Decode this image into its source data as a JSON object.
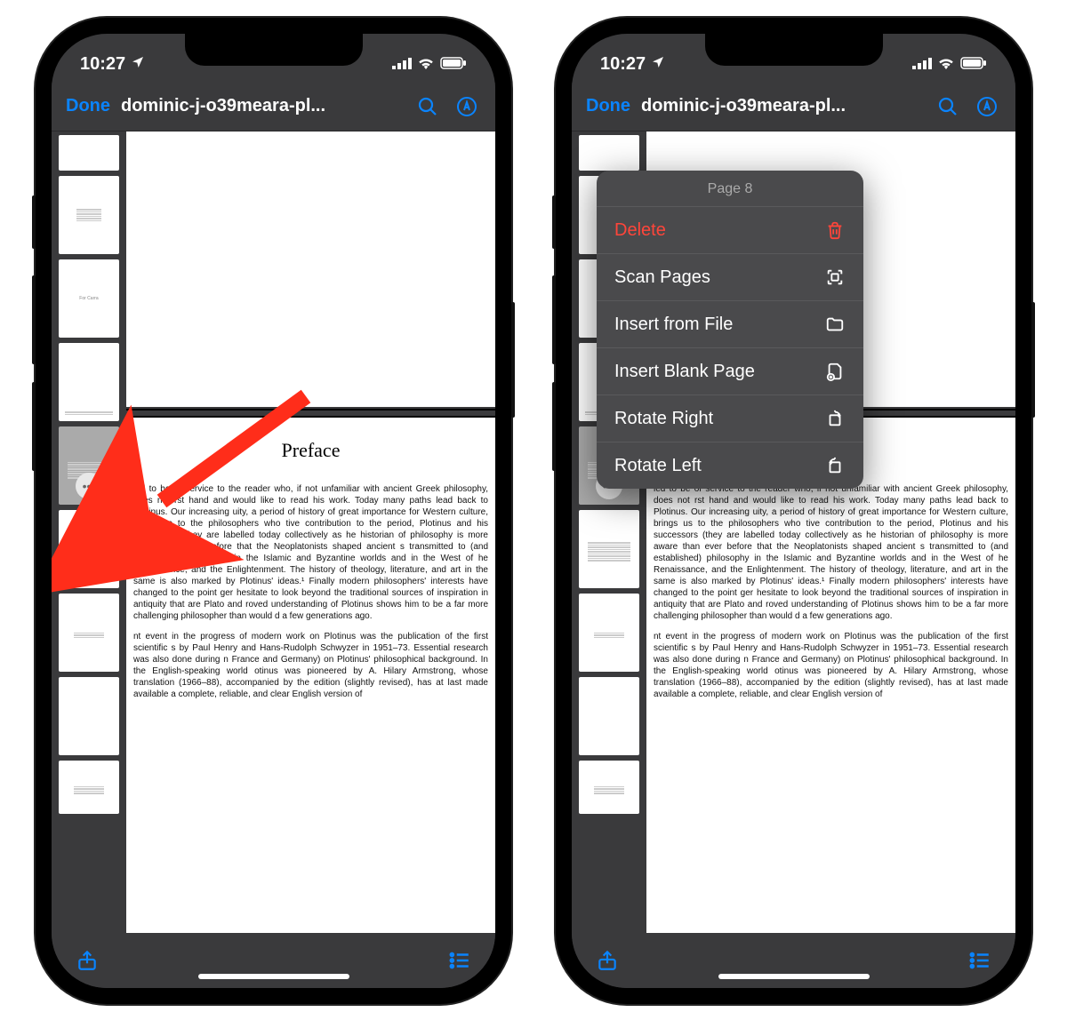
{
  "status": {
    "time": "10:27"
  },
  "nav": {
    "done": "Done",
    "title": "dominic-j-o39meara-pl..."
  },
  "preface": {
    "heading": "Preface",
    "p1": "led to be of service to the reader who, if not unfamiliar with ancient Greek philosophy, does not rst hand and would like to read his work. Today many paths lead back to Plotinus. Our increasing uity, a period of history of great importance for Western culture, brings us to the philosophers who tive contribution to the period, Plotinus and his successors (they are labelled today collectively as he historian of philosophy is more aware than ever before that the Neoplatonists shaped ancient s transmitted to (and established) philosophy in the Islamic and Byzantine worlds and in the West of he Renaissance, and the Enlightenment. The history of theology, literature, and art in the same is also marked by Plotinus' ideas.¹ Finally modern philosophers' interests have changed to the point ger hesitate to look beyond the traditional sources of inspiration in antiquity that are Plato and roved understanding of Plotinus shows him to be a far more challenging philosopher than would d a few generations ago.",
    "p2": "nt event in the progress of modern work on Plotinus was the publication of the first scientific s by Paul Henry and Hans-Rudolph Schwyzer in 1951–73. Essential research was also done during n France and Germany) on Plotinus' philosophical background. In the English-speaking world otinus was pioneered by A. Hilary Armstrong, whose translation (1966–88), accompanied by the edition (slightly revised), has at last made available a complete, reliable, and clear English version of"
  },
  "menu": {
    "title": "Page 8",
    "items": [
      {
        "label": "Delete",
        "icon": "trash",
        "destructive": true
      },
      {
        "label": "Scan Pages",
        "icon": "scan",
        "destructive": false
      },
      {
        "label": "Insert from File",
        "icon": "folder",
        "destructive": false
      },
      {
        "label": "Insert Blank Page",
        "icon": "blankpage",
        "destructive": false
      },
      {
        "label": "Rotate Right",
        "icon": "rot-right",
        "destructive": false
      },
      {
        "label": "Rotate Left",
        "icon": "rot-left",
        "destructive": false
      }
    ]
  }
}
